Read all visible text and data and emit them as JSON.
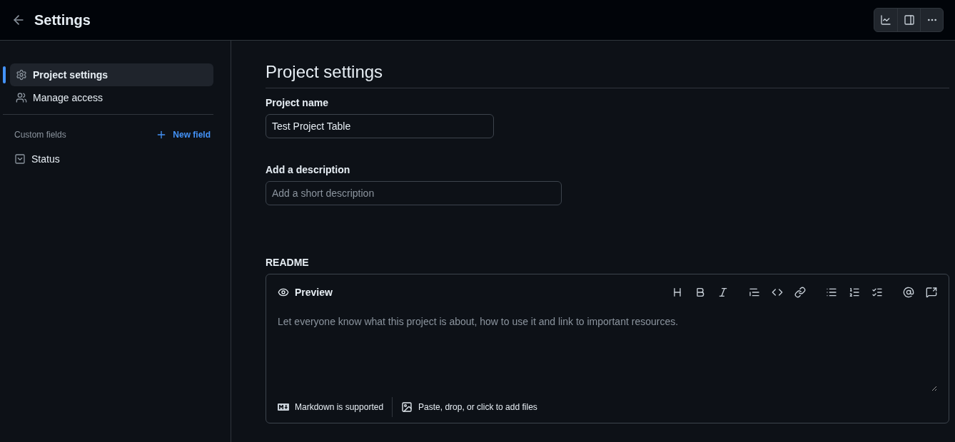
{
  "header": {
    "title": "Settings"
  },
  "sidebar": {
    "items": [
      {
        "label": "Project settings",
        "kind": "settings",
        "selected": true
      },
      {
        "label": "Manage access",
        "kind": "people",
        "selected": false
      }
    ],
    "custom_fields": {
      "heading": "Custom fields",
      "action": "New field",
      "items": [
        {
          "label": "Status",
          "kind": "single-select"
        }
      ]
    }
  },
  "main": {
    "title": "Project settings",
    "project_name": {
      "label": "Project name",
      "value": "Test Project Table"
    },
    "description": {
      "label": "Add a description",
      "placeholder": "Add a short description"
    },
    "readme": {
      "label": "README",
      "tab": "Preview",
      "placeholder": "Let everyone know what this project is about, how to use it and link to important resources.",
      "markdown_note": "Markdown is supported",
      "attach_note": "Paste, drop, or click to add files"
    }
  }
}
